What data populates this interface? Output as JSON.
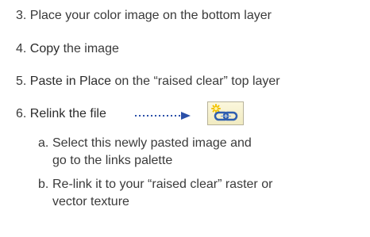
{
  "steps": [
    {
      "num": "3.",
      "text": "Place your color image on the bottom layer"
    },
    {
      "num": "4.",
      "bold": "Copy",
      "rest": "the image"
    },
    {
      "num": "5.",
      "bold": "Paste in Place",
      "rest": "on the “raised clear” top layer"
    },
    {
      "num": "6.",
      "bold": "Relink the file"
    }
  ],
  "substeps": [
    {
      "letter": "a.",
      "text": "Select this newly pasted image and go to the links palette"
    },
    {
      "letter": "b.",
      "text": "Re-link it to your “raised clear” raster or vector texture"
    }
  ],
  "colors": {
    "text": "#3a3a3a",
    "arrow": "#2a4fa8",
    "icon_chain": "#2f5fb0",
    "icon_star": "#f2c200"
  },
  "icons": {
    "relink": "relink-chain-icon",
    "arrow": "dotted-arrow-icon"
  }
}
